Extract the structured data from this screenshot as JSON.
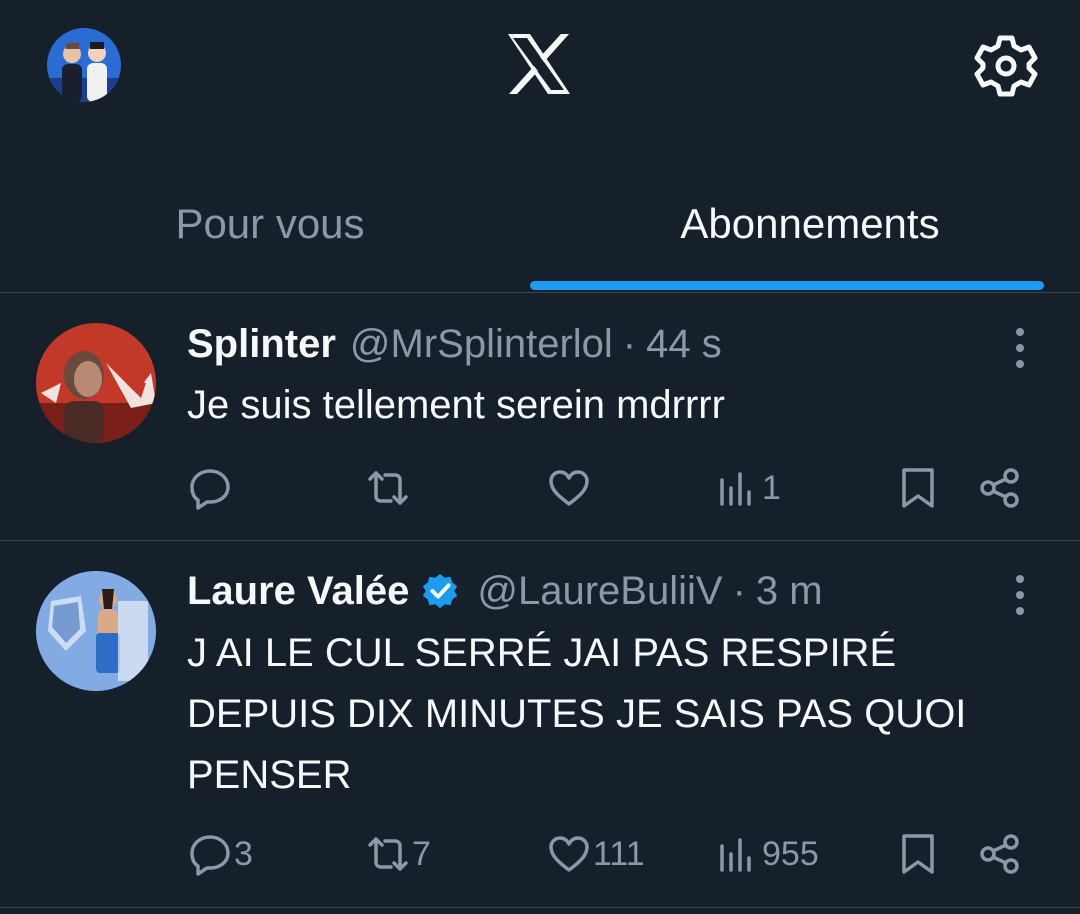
{
  "header": {
    "logo_icon": "x-logo-icon",
    "settings_icon": "gear-icon",
    "avatar_icon": "profile-avatar"
  },
  "tabs": [
    {
      "label": "Pour vous",
      "active": false
    },
    {
      "label": "Abonnements",
      "active": true
    }
  ],
  "colors": {
    "background": "#15202b",
    "accent": "#1d9bf0",
    "muted_text": "#8b98a5",
    "divider": "#38444d"
  },
  "tweets": [
    {
      "name": "Splinter",
      "handle": "@MrSplinterlol",
      "separator": "·",
      "time": "44 s",
      "verified": false,
      "text": "Je suis tellement serein mdrrrr",
      "replies": "",
      "retweets": "",
      "likes": "",
      "views": "1"
    },
    {
      "name": "Laure Valée",
      "handle": "@LaureBuliiV",
      "separator": "·",
      "time": "3 m",
      "verified": true,
      "text": "J AI LE CUL SERRÉ JAI PAS RESPIRÉ DEPUIS DIX MINUTES JE SAIS PAS QUOI PENSER",
      "replies": "3",
      "retweets": "7",
      "likes": "111",
      "views": "955"
    }
  ]
}
